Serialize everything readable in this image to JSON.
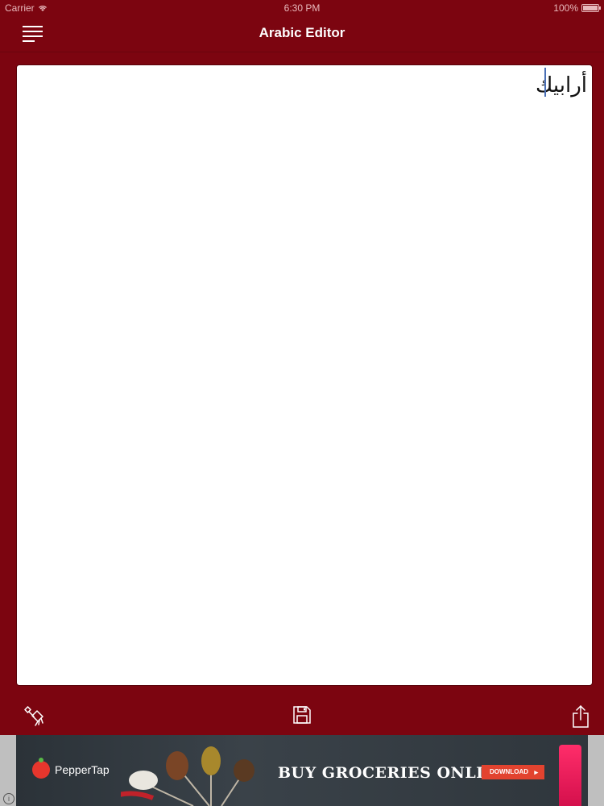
{
  "status": {
    "carrier": "Carrier",
    "time": "6:30 PM",
    "battery": "100%"
  },
  "nav": {
    "title": "Arabic Editor"
  },
  "editor": {
    "text": "أرابيك"
  },
  "ad": {
    "brand": "PepperTap",
    "headline": "BUY GROCERIES ONLINE",
    "cta": "DOWNLOAD",
    "info": "i"
  },
  "colors": {
    "background": "#7c0510",
    "editor": "#ffffff",
    "title": "#ffffff"
  },
  "icons": {
    "menu": "hamburger-menu-icon",
    "clear": "brush-icon",
    "save": "floppy-disk-icon",
    "share": "share-icon"
  }
}
